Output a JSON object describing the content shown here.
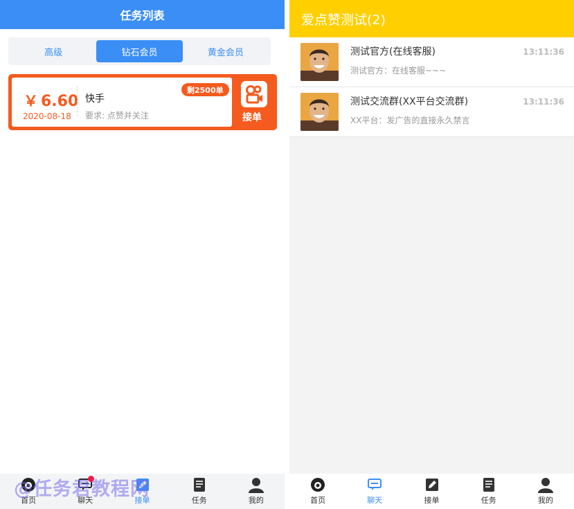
{
  "left": {
    "header_title": "任务列表",
    "tabs": [
      {
        "label": "高级",
        "active": false
      },
      {
        "label": "钻石会员",
        "active": true
      },
      {
        "label": "黄金会员",
        "active": false
      }
    ],
    "task": {
      "currency": "￥",
      "amount": "6.60",
      "date": "2020-08-18",
      "app_name": "快手",
      "requirement": "要求: 点赞并关注",
      "remaining": "剩2500单",
      "accept_label": "接单",
      "app_icon": "kuaishou-icon"
    },
    "nav": [
      {
        "label": "首页",
        "icon": "home-icon"
      },
      {
        "label": "聊天",
        "icon": "chat-icon",
        "badge": true
      },
      {
        "label": "接单",
        "icon": "edit-icon",
        "active": true
      },
      {
        "label": "任务",
        "icon": "document-icon"
      },
      {
        "label": "我的",
        "icon": "user-icon"
      }
    ],
    "watermark": "@任务君教程网"
  },
  "right": {
    "header_title": "爱点赞测试(2)",
    "chats": [
      {
        "title": "测试官方(在线客服)",
        "message": "测试官方：在线客服~~~",
        "time": "13:11:36"
      },
      {
        "title": "测试交流群(XX平台交流群)",
        "message": "XX平台：发广告的直接永久禁言",
        "time": "13:11:36"
      }
    ],
    "nav": [
      {
        "label": "首页",
        "icon": "home-icon"
      },
      {
        "label": "聊天",
        "icon": "chat-icon",
        "active": true
      },
      {
        "label": "接单",
        "icon": "edit-icon"
      },
      {
        "label": "任务",
        "icon": "document-icon"
      },
      {
        "label": "我的",
        "icon": "user-icon"
      }
    ]
  },
  "colors": {
    "blue": "#3a8ef6",
    "orange": "#f55a1e",
    "yellow": "#ffcf00",
    "badge_red": "#f01a4a"
  }
}
